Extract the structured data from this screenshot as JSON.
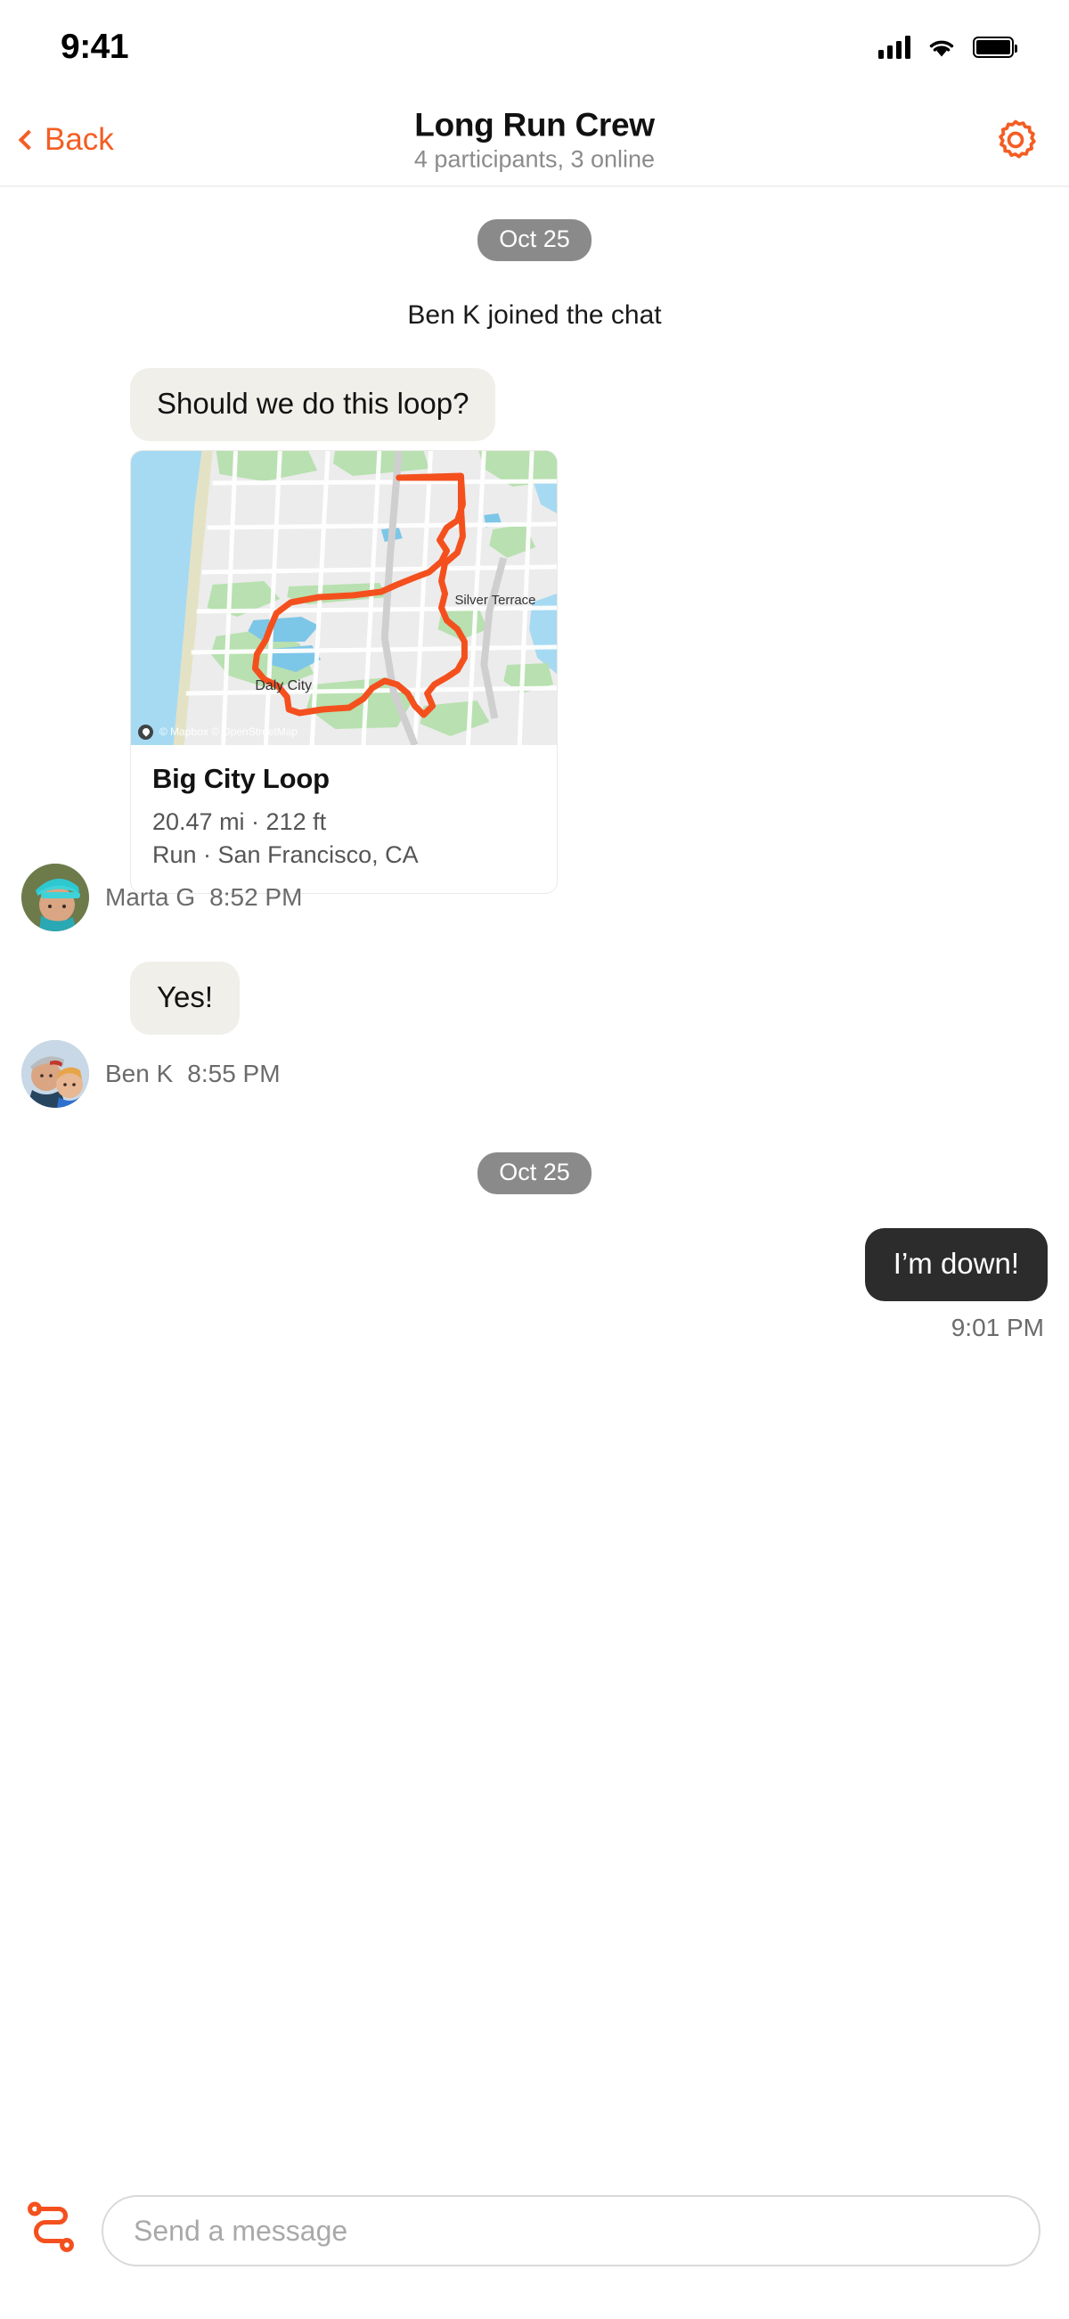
{
  "status_bar": {
    "time": "9:41",
    "icons": [
      "cellular-signal-icon",
      "wifi-icon",
      "battery-icon"
    ]
  },
  "header": {
    "back_label": "Back",
    "title": "Long Run Crew",
    "subtitle": "4 participants, 3 online",
    "settings_icon": "gear-icon",
    "accent_color": "#f45d23"
  },
  "conversation": {
    "date_divider_top": "Oct 25",
    "system_message": "Ben K joined the chat",
    "message_1": {
      "text": "Should we do this loop?",
      "sender": "Marta G",
      "time": "8:52 PM"
    },
    "route_card": {
      "title": "Big City Loop",
      "stats": "20.47 mi · 212 ft",
      "meta": "Run · San Francisco, CA",
      "map_attribution": "© Mapbox © OpenStreetMap",
      "map_labels": [
        "Silver Terrace",
        "Daly City"
      ],
      "route_color": "#f4501e",
      "water_color": "#a5daf2",
      "land_color": "#ececec",
      "park_color": "#b8e0b0"
    },
    "message_2": {
      "text": "Yes!",
      "sender": "Ben K",
      "time": "8:55 PM"
    },
    "date_divider_bottom": "Oct 25",
    "message_3": {
      "text": "I’m down!",
      "time": "9:01 PM",
      "bubble_color": "#2c2c2c"
    }
  },
  "composer": {
    "route_icon": "route-icon",
    "placeholder": "Send a message",
    "value": ""
  }
}
